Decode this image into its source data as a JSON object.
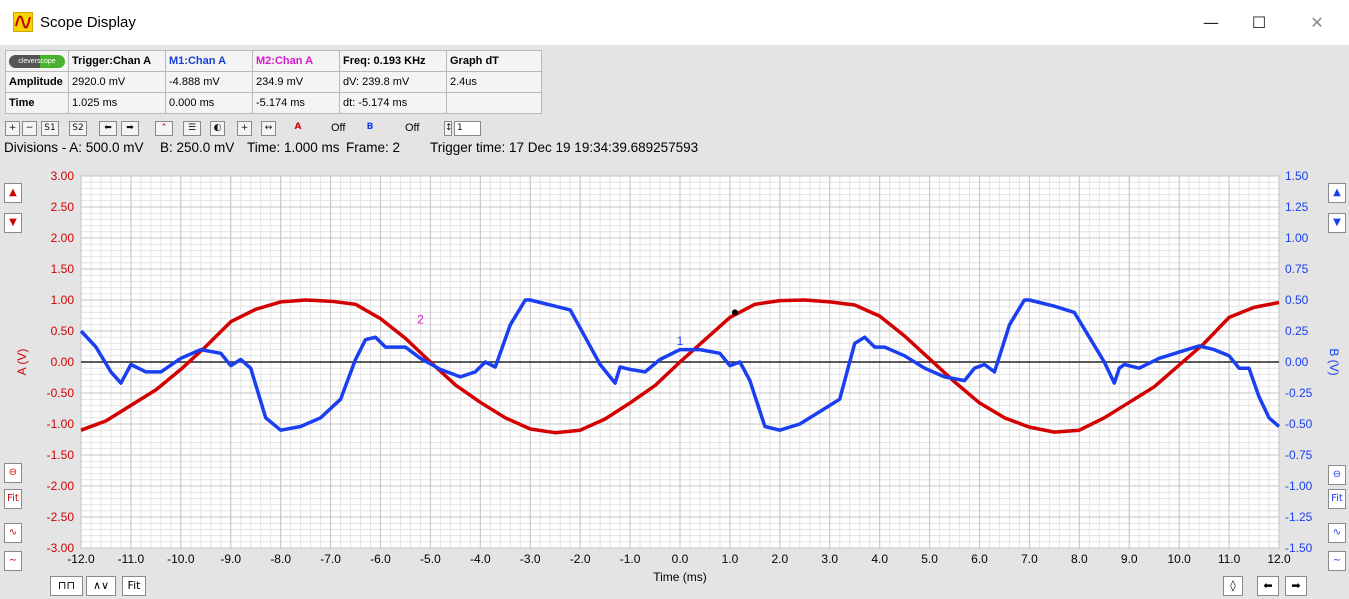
{
  "window": {
    "title": "Scope Display",
    "minimize": "—",
    "maximize": "☐",
    "close": "✕"
  },
  "info_table": {
    "logo_text": "cleverscope",
    "headers": [
      "Trigger:Chan A",
      "M1:Chan A",
      "M2:Chan A",
      "Freq: 0.193 KHz",
      "Graph dT"
    ],
    "header_colors": [
      "#000000",
      "#1a3fd0",
      "#d31acb",
      "#000000",
      "#000000"
    ],
    "rows": [
      {
        "label": "Amplitude",
        "cells": [
          "2920.0 mV",
          "-4.888 mV",
          "234.9 mV",
          "dV: 239.8 mV",
          "2.4us"
        ]
      },
      {
        "label": "Time",
        "cells": [
          "1.025 ms",
          "0.000 ms",
          "-5.174 ms",
          "dt:  -5.174 ms",
          ""
        ]
      }
    ]
  },
  "toolbar": {
    "a_off": "Off",
    "b_off": "Off",
    "frame_spin": "1"
  },
  "status": {
    "divisions": "Divisions -  A: 500.0 mV",
    "b_div": "B: 250.0 mV",
    "time_div": "Time: 1.000 ms",
    "frame": "Frame: 2",
    "trigger_time": "Trigger time: 17 Dec 19 19:34:39.689257593"
  },
  "side_buttons": {
    "fit_left": "Fit",
    "fit_right": "Fit",
    "fit_bottom": "Fit"
  },
  "colors": {
    "chan_a": "#d20000",
    "chan_b": "#1a3ff0",
    "marker2": "#d31acb",
    "grid": "#c4c4c4",
    "plot_bg": "#ffffff"
  },
  "chart_data": {
    "type": "line",
    "xlabel": "Time (ms)",
    "ylabel_left": "A (V)",
    "ylabel_right": "B (V)",
    "xlim": [
      -12,
      12
    ],
    "ylim_left": [
      -3,
      3
    ],
    "ylim_right": [
      -1.5,
      1.5
    ],
    "x_ticks": [
      "-12.0",
      "-11.0",
      "-10.0",
      "-9.0",
      "-8.0",
      "-7.0",
      "-6.0",
      "-5.0",
      "-4.0",
      "-3.0",
      "-2.0",
      "-1.0",
      "0.0",
      "1.0",
      "2.0",
      "3.0",
      "4.0",
      "5.0",
      "6.0",
      "7.0",
      "8.0",
      "9.0",
      "10.0",
      "11.0",
      "12.0"
    ],
    "y_ticks_left": [
      "3.00",
      "2.50",
      "2.00",
      "1.50",
      "1.00",
      "0.50",
      "0.00",
      "-0.50",
      "-1.00",
      "-1.50",
      "-2.00",
      "-2.50",
      "-3.00"
    ],
    "y_ticks_right": [
      "1.50",
      "1.25",
      "1.00",
      "0.75",
      "0.50",
      "0.25",
      "0.00",
      "-0.25",
      "-0.50",
      "-0.75",
      "-1.00",
      "-1.25",
      "-1.50"
    ],
    "grid": true,
    "marker_labels": [
      "1",
      "2"
    ],
    "series": [
      {
        "name": "A (V)",
        "axis": "left",
        "x": [
          -12,
          -11.5,
          -11,
          -10.5,
          -10,
          -9.5,
          -9,
          -8.5,
          -8,
          -7.5,
          -7,
          -6.5,
          -6,
          -5.5,
          -5,
          -4.5,
          -4,
          -3.5,
          -3,
          -2.5,
          -2,
          -1.5,
          -1,
          -0.5,
          0,
          0.5,
          1,
          1.5,
          2,
          2.5,
          3,
          3.5,
          4,
          4.5,
          5,
          5.5,
          6,
          6.5,
          7,
          7.5,
          8,
          8.5,
          9,
          9.5,
          10,
          10.5,
          11,
          11.5,
          12
        ],
        "y": [
          -1.1,
          -0.95,
          -0.7,
          -0.45,
          -0.12,
          0.25,
          0.65,
          0.85,
          0.97,
          1.0,
          0.98,
          0.93,
          0.7,
          0.38,
          0.0,
          -0.37,
          -0.65,
          -0.9,
          -1.08,
          -1.14,
          -1.1,
          -0.92,
          -0.66,
          -0.38,
          0.0,
          0.36,
          0.72,
          0.93,
          0.99,
          1.0,
          0.97,
          0.92,
          0.74,
          0.42,
          0.05,
          -0.32,
          -0.66,
          -0.9,
          -1.05,
          -1.13,
          -1.1,
          -0.9,
          -0.65,
          -0.4,
          -0.05,
          0.3,
          0.72,
          0.88,
          0.96
        ]
      },
      {
        "name": "B (V)",
        "axis": "right",
        "x": [
          -12,
          -11.7,
          -11.4,
          -11.2,
          -11.0,
          -10.7,
          -10.4,
          -10,
          -9.6,
          -9.2,
          -9.0,
          -8.8,
          -8.6,
          -8.3,
          -8,
          -7.6,
          -7.2,
          -6.8,
          -6.5,
          -6.3,
          -6.1,
          -5.9,
          -5.5,
          -5.2,
          -4.8,
          -4.4,
          -4.1,
          -3.9,
          -3.7,
          -3.4,
          -3.1,
          -3.0,
          -2.8,
          -2.5,
          -2.2,
          -1.9,
          -1.6,
          -1.3,
          -1.2,
          -1.0,
          -0.7,
          -0.4,
          0,
          0.4,
          0.8,
          1.0,
          1.2,
          1.4,
          1.7,
          2.0,
          2.4,
          2.8,
          3.2,
          3.5,
          3.7,
          3.9,
          4.1,
          4.5,
          4.9,
          5.3,
          5.7,
          5.9,
          6.1,
          6.3,
          6.6,
          6.9,
          7.0,
          7.2,
          7.5,
          7.9,
          8.2,
          8.5,
          8.7,
          8.8,
          8.9,
          9.2,
          9.6,
          10,
          10.4,
          10.7,
          11.0,
          11.2,
          11.4,
          11.6,
          11.8,
          12
        ],
        "y": [
          0.25,
          0.12,
          -0.08,
          -0.17,
          -0.02,
          -0.08,
          -0.08,
          0.03,
          0.1,
          0.07,
          -0.03,
          0.02,
          -0.05,
          -0.45,
          -0.55,
          -0.52,
          -0.45,
          -0.3,
          0.02,
          0.18,
          0.2,
          0.12,
          0.12,
          0.03,
          -0.06,
          -0.12,
          -0.08,
          0.0,
          -0.04,
          0.3,
          0.5,
          0.5,
          0.48,
          0.45,
          0.42,
          0.2,
          -0.02,
          -0.17,
          -0.04,
          -0.06,
          -0.08,
          0.02,
          0.1,
          0.1,
          0.07,
          -0.03,
          0.0,
          -0.15,
          -0.52,
          -0.55,
          -0.5,
          -0.4,
          -0.3,
          0.15,
          0.2,
          0.12,
          0.12,
          0.05,
          -0.05,
          -0.12,
          -0.15,
          -0.05,
          -0.02,
          -0.08,
          0.3,
          0.5,
          0.5,
          0.48,
          0.45,
          0.4,
          0.2,
          0.0,
          -0.17,
          -0.05,
          -0.02,
          -0.05,
          0.03,
          0.08,
          0.13,
          0.1,
          0.05,
          -0.05,
          -0.05,
          -0.28,
          -0.45,
          -0.52
        ]
      }
    ]
  }
}
